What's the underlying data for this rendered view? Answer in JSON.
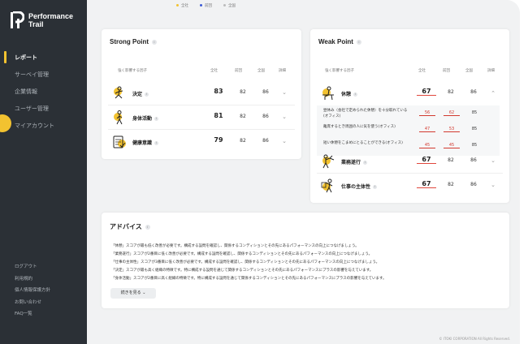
{
  "app": {
    "logo_line1": "Performance",
    "logo_line2": "Trail",
    "accent": "#f2c230"
  },
  "sidebar": {
    "items": [
      {
        "label": "レポート",
        "active": true
      },
      {
        "label": "サーベイ管理",
        "active": false
      },
      {
        "label": "企業情報",
        "active": false
      },
      {
        "label": "ユーザー管理",
        "active": false
      },
      {
        "label": "マイアカウント",
        "active": false
      }
    ],
    "footer_items": [
      "ログアウト",
      "利用規約",
      "個人情報保護方針",
      "お問い合わせ",
      "FAQ一覧"
    ]
  },
  "legend": [
    {
      "label": "全社",
      "color": "#f2c230"
    },
    {
      "label": "前回",
      "color": "#3c5bd6"
    },
    {
      "label": "全国",
      "color": "#bbbbbb"
    }
  ],
  "columns": {
    "factor": "強く影響する因子",
    "company": "全社",
    "previous": "前回",
    "national": "全国",
    "detail": "詳細"
  },
  "strong": {
    "title": "Strong Point",
    "rows": [
      {
        "icon": "person-running-icon",
        "label": "決定",
        "company": "83",
        "previous": "82",
        "national": "86"
      },
      {
        "icon": "person-walking-icon",
        "label": "身体活動",
        "company": "81",
        "previous": "82",
        "national": "86"
      },
      {
        "icon": "clipboard-check-icon",
        "label": "健康意識",
        "company": "79",
        "previous": "82",
        "national": "86"
      }
    ]
  },
  "weak": {
    "title": "Weak Point",
    "rows": [
      {
        "icon": "person-resting-icon",
        "label": "休憩",
        "company": "67",
        "previous": "82",
        "national": "86"
      },
      {
        "icon": "person-working-icon",
        "label": "業務遂行",
        "company": "67",
        "previous": "82",
        "national": "86"
      },
      {
        "icon": "person-thinking-icon",
        "label": "仕事の主体性",
        "company": "67",
        "previous": "82",
        "national": "86"
      }
    ],
    "sub_rows": [
      {
        "text": "昼休み（会社で定められた休憩）を十分取れている(オフィス)",
        "company": "56",
        "previous": "62",
        "national": "85"
      },
      {
        "text": "離席するとき周囲の人に気を使う(オフィス)",
        "company": "47",
        "previous": "53",
        "national": "85"
      },
      {
        "text": "短い休憩をこまめにとることができる(オフィス)",
        "company": "45",
        "previous": "45",
        "national": "85"
      }
    ]
  },
  "advice": {
    "title": "アドバイス",
    "lines": [
      "「休憩」スコアが最も低く改善が必要です。構成する設問を確認し、関係するコンディションとその先にあるパフォーマンスの向上につなげましょう。",
      "「業務遂行」スコアが2番目に低く改善が必要です。構成する設問を確認し、関係するコンディションとその先にあるパフォーマンスの向上につなげましょう。",
      "「仕事の主体性」スコアが3番目に低く改善が必要です。構成する設問を確認し、関係するコンディションとその先にあるパフォーマンスの向上につなげましょう。",
      "「決定」スコアが最も高く組織の特徴です。特に構成する設問を通じて関係するコンディションとその先にあるパフォーマンスにプラスの影響を与えています。",
      "「身体活動」スコアが2番目に高く組織の特徴です。特に構成する設問を通じて関係するコンディションとその先にあるパフォーマンスにプラスの影響を与えています。"
    ],
    "more_label": "続きを見る"
  },
  "footer": {
    "copyright": "© ITOKI CORPORATION All Rights Reserved."
  }
}
